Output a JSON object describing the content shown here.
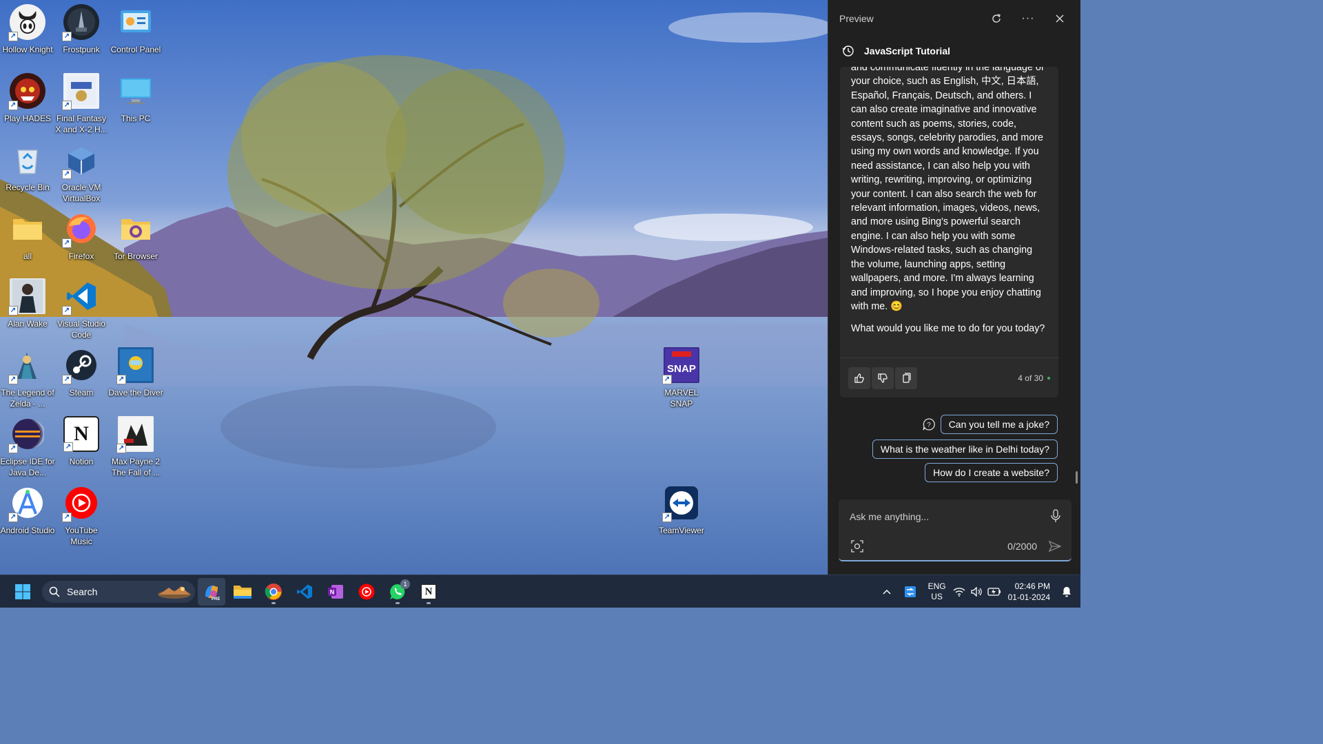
{
  "desktop": {
    "icons": [
      {
        "label": "Hollow Knight",
        "icon": "hollow-knight-icon",
        "shortcut": true
      },
      {
        "label": "Frostpunk",
        "icon": "frostpunk-icon",
        "shortcut": true
      },
      {
        "label": "Control Panel",
        "icon": "control-panel-icon",
        "shortcut": false
      },
      {
        "label": "Play HADES",
        "icon": "hades-icon",
        "shortcut": true
      },
      {
        "label": "Final Fantasy X and X-2 H...",
        "icon": "final-fantasy-icon",
        "shortcut": true
      },
      {
        "label": "This PC",
        "icon": "this-pc-icon",
        "shortcut": false
      },
      {
        "label": "Recycle Bin",
        "icon": "recycle-bin-icon",
        "shortcut": false
      },
      {
        "label": "Oracle VM VirtualBox",
        "icon": "virtualbox-icon",
        "shortcut": true
      },
      {
        "label": "all",
        "icon": "folder-icon",
        "shortcut": false
      },
      {
        "label": "Firefox",
        "icon": "firefox-icon",
        "shortcut": true
      },
      {
        "label": "Tor Browser",
        "icon": "tor-browser-icon",
        "shortcut": false
      },
      {
        "label": "Alan Wake",
        "icon": "alan-wake-icon",
        "shortcut": true
      },
      {
        "label": "Visual Studio Code",
        "icon": "vscode-icon",
        "shortcut": true
      },
      {
        "label": "The Legend of Zelda - ...",
        "icon": "zelda-icon",
        "shortcut": true
      },
      {
        "label": "Steam",
        "icon": "steam-icon",
        "shortcut": true
      },
      {
        "label": "Dave the Diver",
        "icon": "dave-the-diver-icon",
        "shortcut": true
      },
      {
        "label": "MARVEL SNAP",
        "icon": "marvel-snap-icon",
        "shortcut": true
      },
      {
        "label": "Eclipse IDE for Java De...",
        "icon": "eclipse-icon",
        "shortcut": true
      },
      {
        "label": "Notion",
        "icon": "notion-icon",
        "shortcut": true
      },
      {
        "label": "Max Payne 2 The Fall of ...",
        "icon": "max-payne-icon",
        "shortcut": true
      },
      {
        "label": "Android Studio",
        "icon": "android-studio-icon",
        "shortcut": true
      },
      {
        "label": "YouTube Music",
        "icon": "youtube-music-icon",
        "shortcut": true
      },
      {
        "label": "TeamViewer",
        "icon": "teamviewer-icon",
        "shortcut": true
      }
    ]
  },
  "panel": {
    "title": "Preview",
    "conversation_title": "JavaScript Tutorial",
    "message_paragraphs": [
      "and communicate fluently in the language of your choice, such as English, 中文, 日本語, Español, Français, Deutsch, and others. I can also create imaginative and innovative content such as poems, stories, code, essays, songs, celebrity parodies, and more using my own words and knowledge. If you need assistance, I can also help you with writing, rewriting, improving, or optimizing your content. I can also search the web for relevant information, images, videos, news, and more using Bing's powerful search engine. I can also help you with some Windows-related tasks, such as changing the volume, launching apps, setting wallpapers, and more. I'm always learning and improving, so I hope you enjoy chatting with me. 😊",
      "What would you like me to do for you today?"
    ],
    "response_count": "4 of 30",
    "suggestions": [
      "Can you tell me a joke?",
      "What is the weather like in Delhi today?",
      "How do I create a website?"
    ],
    "input_placeholder": "Ask me anything...",
    "char_count": "0/2000",
    "accent_color": "#7fa8d8"
  },
  "taskbar": {
    "search_label": "Search",
    "apps": [
      "copilot-icon",
      "file-explorer-icon",
      "chrome-icon",
      "vscode-icon",
      "onenote-icon",
      "youtube-music-icon",
      "whatsapp-icon",
      "notion-icon"
    ],
    "whatsapp_badge": "1",
    "lang_line1": "ENG",
    "lang_line2": "US",
    "time": "02:46 PM",
    "date": "01-01-2024"
  }
}
